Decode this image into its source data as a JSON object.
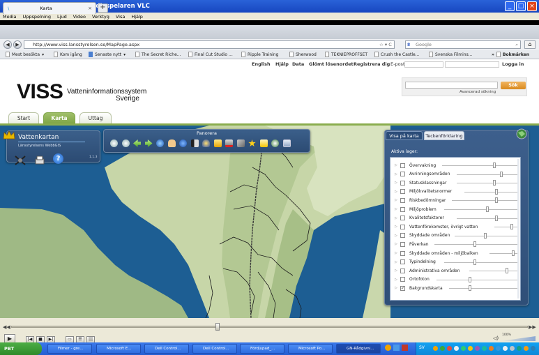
{
  "window": {
    "title": "GN-Rådgivning.mp4 - Mediaspelaren VLC"
  },
  "vlc_menu": [
    "Media",
    "Uppspelning",
    "Ljud",
    "Video",
    "Verktyg",
    "Visa",
    "Hjälp"
  ],
  "browser": {
    "tab_title": "Karta",
    "url": "http://www.viss.lansstyrelsen.se/MapPage.aspx",
    "search_engine": "Google",
    "bookmarks": [
      "Mest besökta",
      "Kom igång",
      "Senaste nytt",
      "The Secret Riche...",
      "Final Cut Studio ...",
      "Ripple Training",
      "Sherwood",
      "TEKNIEPROFFSET",
      "Crush the Castle...",
      "Svenska Filmins...",
      "Bokmärken"
    ]
  },
  "site": {
    "top_links": [
      "English",
      "Hjälp",
      "Data",
      "Glömt lösenordet",
      "Registrera dig",
      "E-post"
    ],
    "login": "Logga in",
    "logo": "VISS",
    "logo_line1": "Vatteninformationssystem",
    "logo_line2": "Sverige",
    "search_button": "Sök",
    "advanced_search": "Avancerad sökning",
    "nav_tabs": [
      "Start",
      "Karta",
      "Uttag"
    ],
    "active_tab": "Karta"
  },
  "map": {
    "panel_title": "Vattenkartan",
    "panel_subtitle": "Länsstyrelsens WebbGIS",
    "panel_version": "1.1.3",
    "toolbar_title": "Panorera",
    "right_tabs": [
      "Visa på karta",
      "Teckenförklaring"
    ],
    "layers_label": "Aktiva lager:",
    "layers": [
      {
        "name": "Övervakning",
        "checked": false,
        "opacity": 0.78
      },
      {
        "name": "Avrinningsområden",
        "checked": false,
        "opacity": 0.85
      },
      {
        "name": "Statusklassningar",
        "checked": false,
        "opacity": 0.78
      },
      {
        "name": "Miljökvalitetsnormer",
        "checked": false,
        "opacity": 0.8
      },
      {
        "name": "Riskbedömningar",
        "checked": false,
        "opacity": 0.8
      },
      {
        "name": "Miljöproblem",
        "checked": false,
        "opacity": 0.72
      },
      {
        "name": "Kvalitetsfaktorer",
        "checked": false,
        "opacity": 0.8
      },
      {
        "name": "Vattenförekomster, övrigt vatten",
        "checked": false,
        "opacity": 0.95
      },
      {
        "name": "Skyddade områden",
        "checked": false,
        "opacity": 0.7
      },
      {
        "name": "Påverkan",
        "checked": false,
        "opacity": 0.6
      },
      {
        "name": "Skyddade områden - miljöbalken",
        "checked": false,
        "opacity": 0.96
      },
      {
        "name": "Typindelning",
        "checked": false,
        "opacity": 0.6
      },
      {
        "name": "Administrativa områden",
        "checked": false,
        "opacity": 0.9
      },
      {
        "name": "Ortofoton",
        "checked": false,
        "opacity": 0.55
      },
      {
        "name": "Bakgrundskarta",
        "checked": true,
        "opacity": 0.55
      }
    ]
  },
  "vlc": {
    "volume": "100%",
    "seek_fraction": 0.4
  },
  "taskbar": {
    "start": "PBT",
    "tasks": [
      "Filmer - gre...",
      "Microsoft E...",
      "Dell Control...",
      "Dell Control...",
      "Fördjupad_...",
      "Microsoft Po...",
      "GN-Rådgivni..."
    ],
    "lang": "SV"
  },
  "colors": {
    "accent_green": "#8aad4e",
    "vlc_blue": "#245ed2",
    "search_orange": "#d9891e"
  }
}
